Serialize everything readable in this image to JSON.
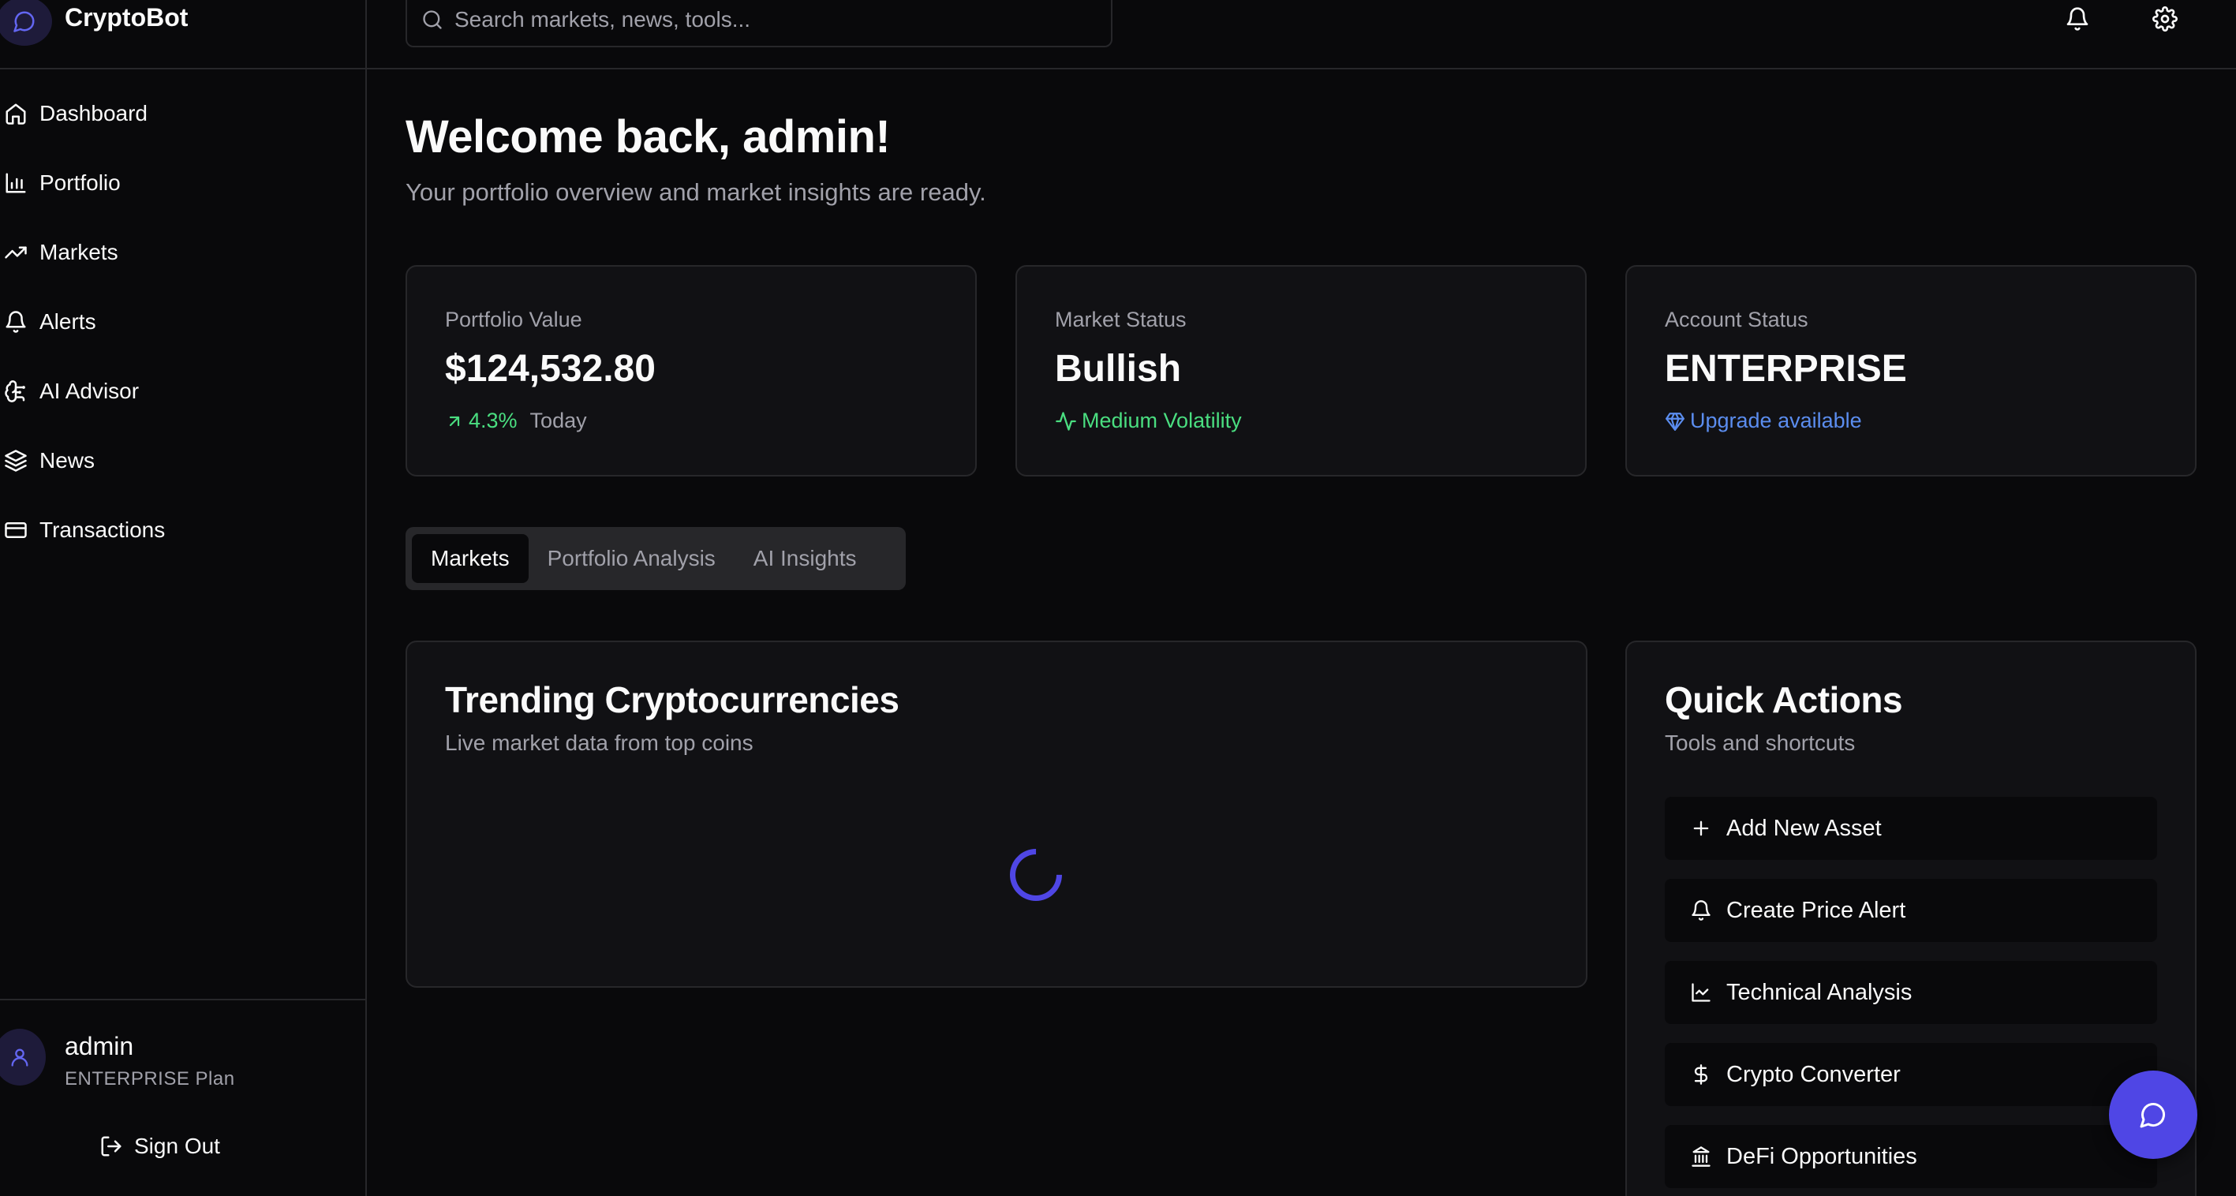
{
  "brand": {
    "name": "CryptoBot",
    "logo_icon": "message-circle-icon"
  },
  "search": {
    "placeholder": "Search markets, news, tools..."
  },
  "sidebar": {
    "items": [
      {
        "label": "Dashboard",
        "icon": "home-icon"
      },
      {
        "label": "Portfolio",
        "icon": "bar-chart-icon"
      },
      {
        "label": "Markets",
        "icon": "trending-up-icon"
      },
      {
        "label": "Alerts",
        "icon": "bell-icon"
      },
      {
        "label": "AI Advisor",
        "icon": "brain-icon"
      },
      {
        "label": "News",
        "icon": "layers-icon"
      },
      {
        "label": "Transactions",
        "icon": "credit-card-icon"
      }
    ]
  },
  "user": {
    "name": "admin",
    "plan": "ENTERPRISE Plan",
    "sign_out": "Sign Out"
  },
  "header": {
    "title": "Welcome back, admin!",
    "subtitle": "Your portfolio overview and market insights are ready."
  },
  "stats": {
    "portfolio": {
      "label": "Portfolio Value",
      "value": "$124,532.80",
      "change": "4.3%",
      "period": "Today"
    },
    "market": {
      "label": "Market Status",
      "value": "Bullish",
      "note": "Medium Volatility"
    },
    "account": {
      "label": "Account Status",
      "value": "ENTERPRISE",
      "note": "Upgrade available"
    }
  },
  "tabs": [
    "Markets",
    "Portfolio Analysis",
    "AI Insights"
  ],
  "active_tab": "Markets",
  "trending": {
    "title": "Trending Cryptocurrencies",
    "subtitle": "Live market data from top coins"
  },
  "quick_actions": {
    "title": "Quick Actions",
    "subtitle": "Tools and shortcuts",
    "items": [
      {
        "label": "Add New Asset",
        "icon": "plus-icon"
      },
      {
        "label": "Create Price Alert",
        "icon": "bell-icon"
      },
      {
        "label": "Technical Analysis",
        "icon": "line-chart-icon"
      },
      {
        "label": "Crypto Converter",
        "icon": "dollar-icon"
      },
      {
        "label": "DeFi Opportunities",
        "icon": "bank-icon"
      }
    ]
  },
  "colors": {
    "accent": "#4f46e5",
    "positive": "#4ade80",
    "link": "#5b8def",
    "muted": "#a1a1aa"
  }
}
